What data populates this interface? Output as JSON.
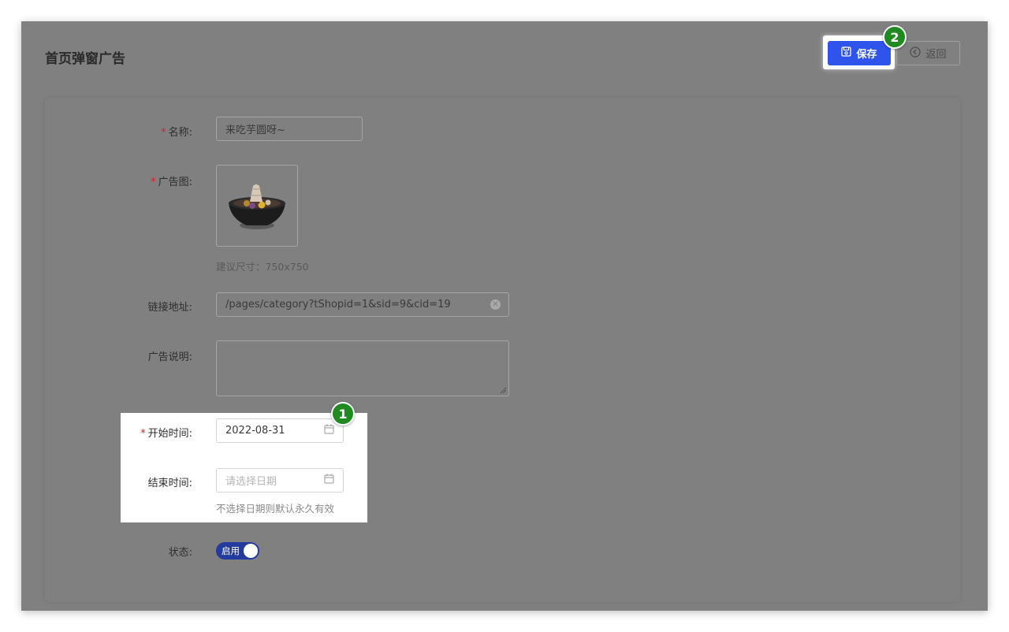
{
  "header": {
    "title": "首页弹窗广告",
    "save_label": "保存",
    "back_label": "返回"
  },
  "badges": {
    "one": "1",
    "two": "2"
  },
  "form": {
    "name": {
      "label": "名称:",
      "value": "来吃芋圆呀~"
    },
    "image": {
      "label": "广告图:",
      "hint": "建议尺寸：750x750"
    },
    "link": {
      "label": "链接地址:",
      "value": "/pages/category?tShopid=1&sid=9&cid=19"
    },
    "description": {
      "label": "广告说明:",
      "value": ""
    },
    "start_time": {
      "label": "开始时间:",
      "value": "2022-08-31"
    },
    "end_time": {
      "label": "结束时间:",
      "placeholder": "请选择日期",
      "hint": "不选择日期则默认永久有效"
    },
    "status": {
      "label": "状态:",
      "switch_text": "启用",
      "on": true
    }
  },
  "required_mark": "*",
  "colors": {
    "primary": "#2f54eb",
    "badge": "#1f8a1f",
    "required": "#e0211b",
    "switch_on": "#233a9e"
  }
}
